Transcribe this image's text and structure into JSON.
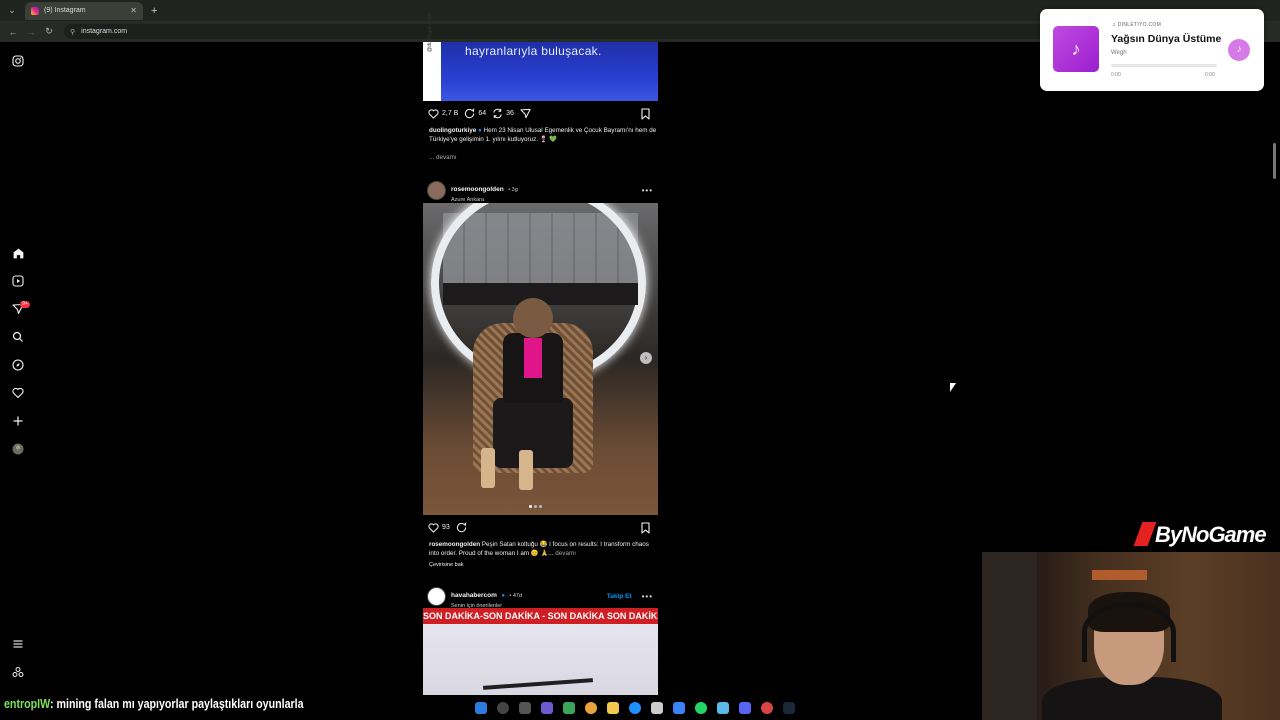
{
  "browser": {
    "tab_title": "(9) Instagram",
    "tab_close": "✕",
    "new_tab": "+",
    "url": "instagram.com"
  },
  "sidebar": {
    "items": [
      "instagram-logo",
      "home",
      "reels",
      "messages",
      "search",
      "explore",
      "notifications",
      "create",
      "profile",
      "more",
      "also-from-meta"
    ],
    "messages_badge": "9+"
  },
  "posts": [
    {
      "image_caption_text": "hayranlarıyla buluşacak.",
      "image_side_label": "@duolingoturkiye",
      "likes": "2,7 B",
      "comments": "64",
      "reposts": "36",
      "caption_user": "duolingoturkiye",
      "caption_text": "Hem 23 Nisan Ulusal Egemenlik ve Çocuk Bayramı'nı hem de Türkiye'ye gelişimin 1. yılını kutluyoruz. 🍷 💚",
      "more": "... devamı"
    },
    {
      "username": "rosemoongolden",
      "time": "• 3g",
      "location": "Azure Ankara",
      "likes": "93",
      "caption_user": "rosemoongolden",
      "caption_text": "Peşin Satan koltuğu 😂 I focus on results: I transform chaos into order. Proud of the woman I am 😊 🙏...",
      "more": "devamı",
      "translate": "Çevirisine bak"
    },
    {
      "username": "havahabercom",
      "time": "• 47d",
      "subtitle": "Senin için önerilenler",
      "follow": "Takip Et",
      "banner": "SON DAKİKA-SON DAKİKA - SON DAKİKA SON DAKİKA"
    }
  ],
  "music": {
    "source": "♫ DINLETIYO.COM",
    "title": "Yağsın Dünya Üstüme",
    "artist": "Wegh",
    "time_start": "0:00",
    "time_end": "0:00",
    "progress": 0
  },
  "overlay": {
    "brand": "ByNoGame",
    "chat_user": "entropIW",
    "chat_message": ": mining falan mı yapıyorlar paylaştıkları oyunlarla"
  },
  "colors": {
    "accent_blue": "#0095f6",
    "badge_red": "#ff3040",
    "banner_red": "#cf1f25",
    "music_purple": "#c14ae0",
    "chat_user_green": "#7de05a"
  }
}
